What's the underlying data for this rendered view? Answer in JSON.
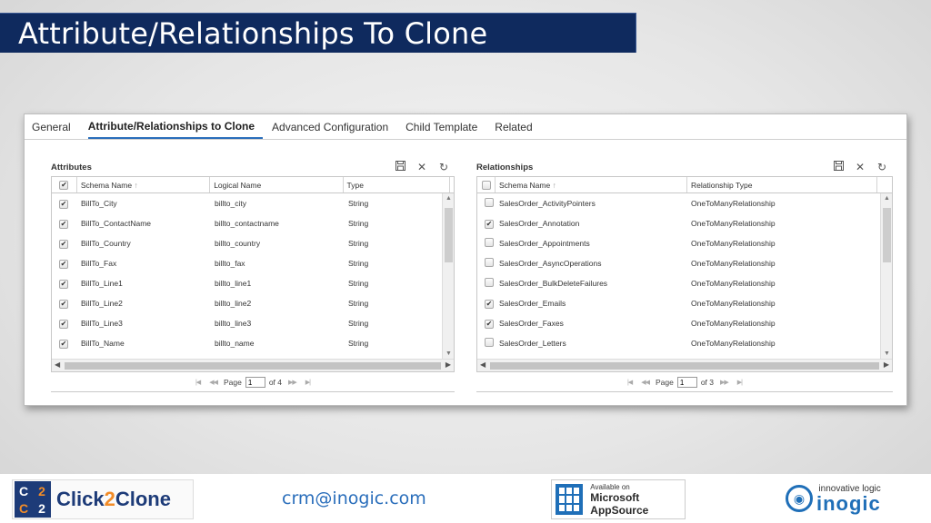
{
  "slide": {
    "title": "Attribute/Relationships To Clone"
  },
  "tabs": [
    {
      "label": "General",
      "active": false
    },
    {
      "label": "Attribute/Relationships to Clone",
      "active": true
    },
    {
      "label": "Advanced Configuration",
      "active": false
    },
    {
      "label": "Child Template",
      "active": false
    },
    {
      "label": "Related",
      "active": false
    }
  ],
  "attributes": {
    "title": "Attributes",
    "columns": [
      "Schema Name",
      "Logical Name",
      "Type"
    ],
    "sort_glyph": "↑",
    "rows": [
      {
        "schema": "BillTo_City",
        "logical": "billto_city",
        "type": "String",
        "checked": true
      },
      {
        "schema": "BillTo_ContactName",
        "logical": "billto_contactname",
        "type": "String",
        "checked": true
      },
      {
        "schema": "BillTo_Country",
        "logical": "billto_country",
        "type": "String",
        "checked": true
      },
      {
        "schema": "BillTo_Fax",
        "logical": "billto_fax",
        "type": "String",
        "checked": true
      },
      {
        "schema": "BillTo_Line1",
        "logical": "billto_line1",
        "type": "String",
        "checked": true
      },
      {
        "schema": "BillTo_Line2",
        "logical": "billto_line2",
        "type": "String",
        "checked": true
      },
      {
        "schema": "BillTo_Line3",
        "logical": "billto_line3",
        "type": "String",
        "checked": true
      },
      {
        "schema": "BillTo_Name",
        "logical": "billto_name",
        "type": "String",
        "checked": true
      }
    ],
    "pager": {
      "page_label": "Page",
      "page_value": "1",
      "of_label": "of 4"
    }
  },
  "relationships": {
    "title": "Relationships",
    "columns": [
      "Schema Name",
      "Relationship Type"
    ],
    "sort_glyph": "↑",
    "rows": [
      {
        "schema": "SalesOrder_ActivityPointers",
        "type": "OneToManyRelationship",
        "checked": false
      },
      {
        "schema": "SalesOrder_Annotation",
        "type": "OneToManyRelationship",
        "checked": true
      },
      {
        "schema": "SalesOrder_Appointments",
        "type": "OneToManyRelationship",
        "checked": false
      },
      {
        "schema": "SalesOrder_AsyncOperations",
        "type": "OneToManyRelationship",
        "checked": false
      },
      {
        "schema": "SalesOrder_BulkDeleteFailures",
        "type": "OneToManyRelationship",
        "checked": false
      },
      {
        "schema": "SalesOrder_Emails",
        "type": "OneToManyRelationship",
        "checked": true
      },
      {
        "schema": "SalesOrder_Faxes",
        "type": "OneToManyRelationship",
        "checked": true
      },
      {
        "schema": "SalesOrder_Letters",
        "type": "OneToManyRelationship",
        "checked": false
      }
    ],
    "pager": {
      "page_label": "Page",
      "page_value": "1",
      "of_label": "of 3"
    }
  },
  "icons": {
    "save": "💾",
    "close": "✕",
    "refresh": "↻",
    "check": "✔"
  },
  "footer": {
    "brand_mark": [
      "C",
      "2",
      "C",
      "2"
    ],
    "brand_name_a": "Click",
    "brand_name_b": "2",
    "brand_name_c": "Clone",
    "email": "crm@inogic.com",
    "appsource_small": "Available on",
    "appsource_big": "Microsoft AppSource",
    "inogic_tag": "innovative logic",
    "inogic_name": "inogic"
  },
  "colors": {
    "title_bg": "#0f2a5e",
    "accent": "#2a6ebb",
    "brand_orange": "#f28c28"
  }
}
